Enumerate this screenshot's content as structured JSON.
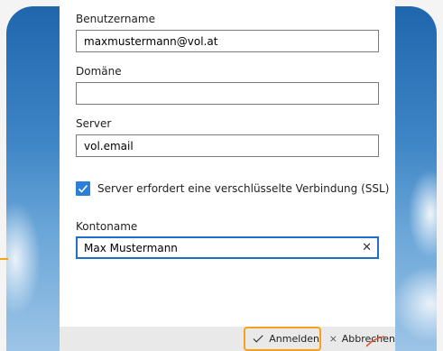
{
  "form": {
    "username": {
      "label": "Benutzername",
      "value": "maxmustermann@vol.at"
    },
    "domain": {
      "label": "Domäne",
      "value": ""
    },
    "server": {
      "label": "Server",
      "value": "vol.email"
    },
    "ssl": {
      "label": "Server erfordert eine verschlüsselte Verbindung (SSL)",
      "checked": true
    },
    "account": {
      "label": "Kontoname",
      "value": "Max Mustermann"
    }
  },
  "footer": {
    "signin_label": "Anmelden",
    "cancel_label": "Abbrechen"
  },
  "colors": {
    "accent": "#1e6fc8",
    "highlight": "#f4a21c"
  },
  "icons": [
    "checkmark-icon",
    "close-icon",
    "clear-icon"
  ]
}
